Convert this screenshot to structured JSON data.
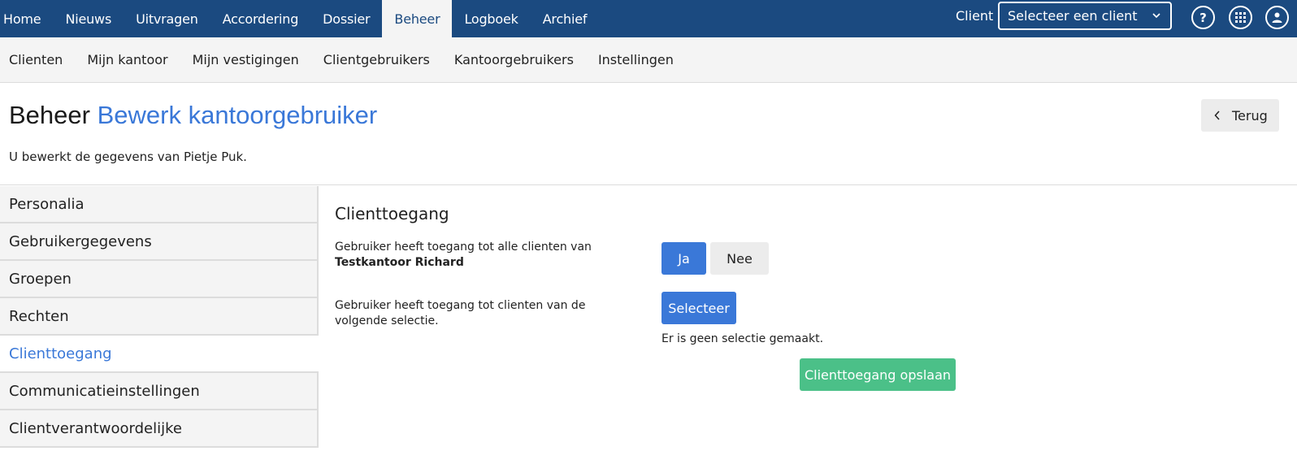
{
  "topnav": {
    "items": [
      "Home",
      "Nieuws",
      "Uitvragen",
      "Accordering",
      "Dossier",
      "Beheer",
      "Logboek",
      "Archief"
    ],
    "active": "Beheer"
  },
  "client": {
    "label": "Client",
    "select_value": "Selecteer een client"
  },
  "top_icons": [
    "help-icon",
    "apps-grid-icon",
    "user-icon"
  ],
  "help_glyph": "?",
  "subnav": {
    "items": [
      "Clienten",
      "Mijn kantoor",
      "Mijn vestigingen",
      "Clientgebruikers",
      "Kantoorgebruikers",
      "Instellingen"
    ]
  },
  "header": {
    "title": "Beheer",
    "subtitle": "Bewerk kantoorgebruiker",
    "intro": "U bewerkt de gegevens van Pietje Puk.",
    "back_label": "Terug"
  },
  "sidebar": {
    "items": [
      "Personalia",
      "Gebruikergegevens",
      "Groepen",
      "Rechten",
      "Clienttoegang",
      "Communicatieinstellingen",
      "Clientverantwoordelijke"
    ],
    "active": "Clienttoegang"
  },
  "content": {
    "section_title": "Clienttoegang",
    "row1_label": "Gebruiker heeft toegang tot alle clienten van",
    "row1_office": "Testkantoor Richard",
    "ja_label": "Ja",
    "nee_label": "Nee",
    "row2_label": "Gebruiker heeft toegang tot clienten van de volgende selectie.",
    "selecteer_label": "Selecteer",
    "no_selection": "Er is geen selectie gemaakt.",
    "save_label": "Clienttoegang opslaan"
  },
  "colors": {
    "topbar": "#1b4a80",
    "accent": "#3a78d8",
    "save": "#4bc088"
  }
}
